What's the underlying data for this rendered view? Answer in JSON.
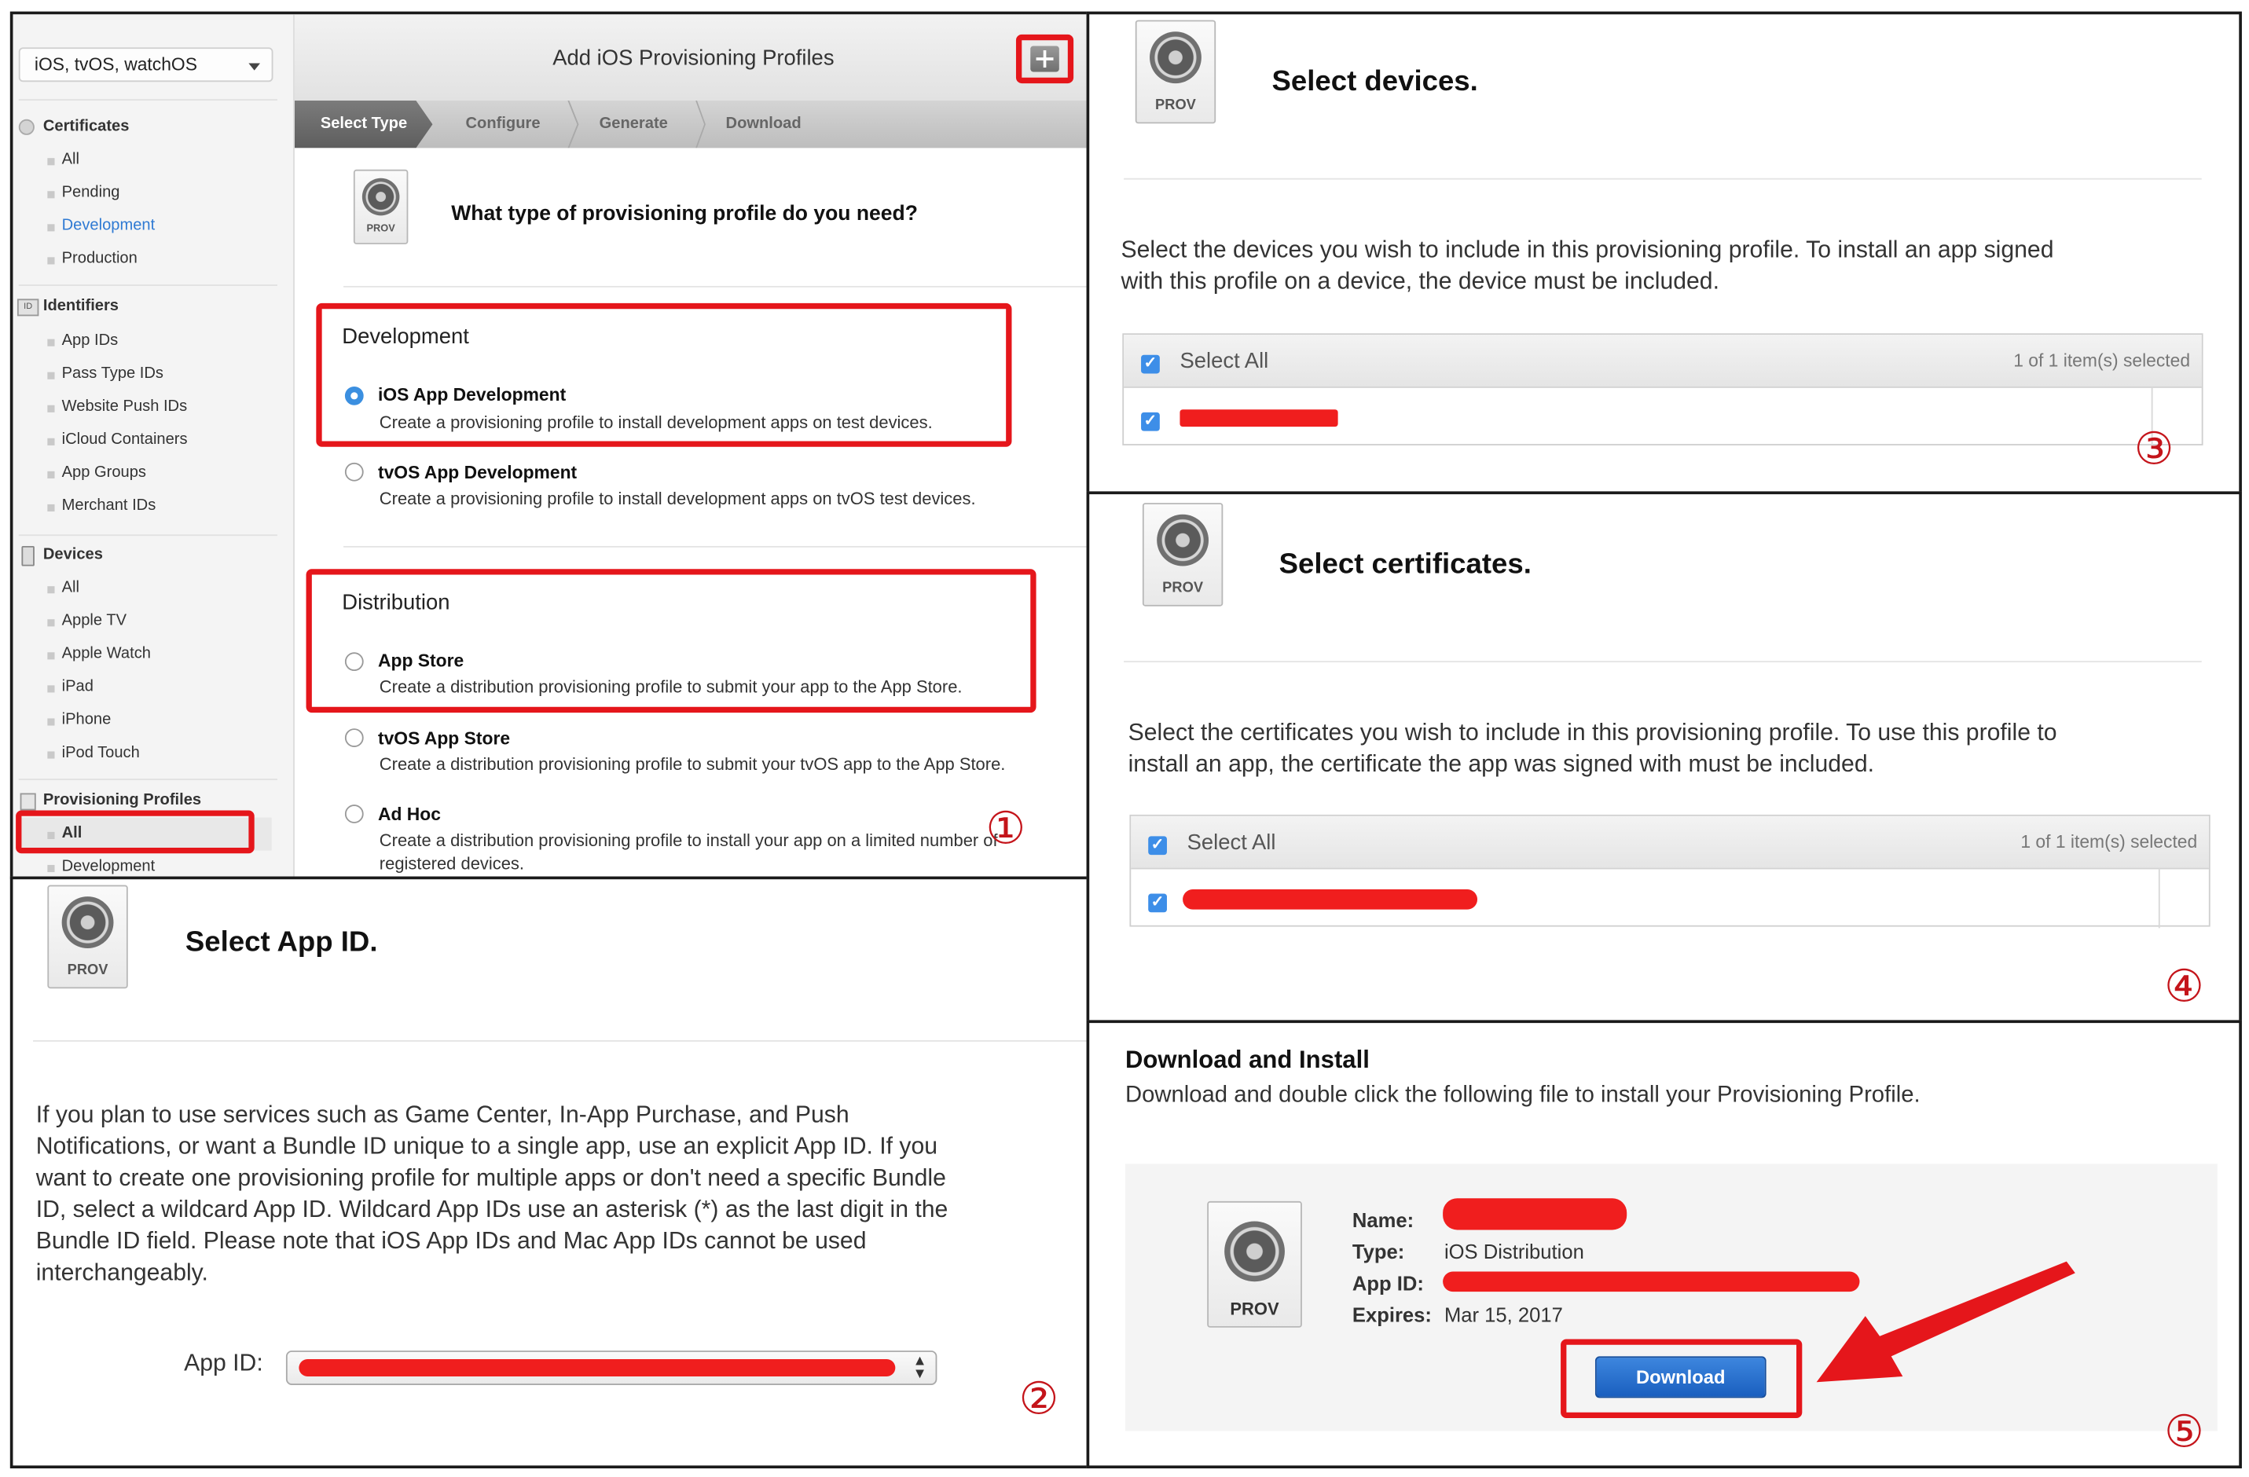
{
  "panel1": {
    "platform_select": "iOS, tvOS, watchOS",
    "header_title": "Add iOS Provisioning Profiles",
    "add_icon": "plus-icon",
    "steps": [
      "Select Type",
      "Configure",
      "Generate",
      "Download"
    ],
    "question": "What type of provisioning profile do you need?",
    "sidebar": {
      "certificates": {
        "title": "Certificates",
        "items": [
          "All",
          "Pending",
          "Development",
          "Production"
        ]
      },
      "identifiers": {
        "title": "Identifiers",
        "items": [
          "App IDs",
          "Pass Type IDs",
          "Website Push IDs",
          "iCloud Containers",
          "App Groups",
          "Merchant IDs"
        ]
      },
      "devices": {
        "title": "Devices",
        "items": [
          "All",
          "Apple TV",
          "Apple Watch",
          "iPad",
          "iPhone",
          "iPod Touch"
        ]
      },
      "profiles": {
        "title": "Provisioning Profiles",
        "items": [
          "All",
          "Development"
        ]
      },
      "identifiers_badge": "ID"
    },
    "development": {
      "heading": "Development",
      "options": [
        {
          "title": "iOS App Development",
          "desc": "Create a provisioning profile to install development apps on test devices."
        },
        {
          "title": "tvOS App Development",
          "desc": "Create a provisioning profile to install development apps on tvOS test devices."
        }
      ]
    },
    "distribution": {
      "heading": "Distribution",
      "options": [
        {
          "title": "App Store",
          "desc": "Create a distribution provisioning profile to submit your app to the App Store."
        },
        {
          "title": "tvOS App Store",
          "desc": "Create a distribution provisioning profile to submit your tvOS app to the App Store."
        },
        {
          "title": "Ad Hoc",
          "desc": "Create a distribution provisioning profile to install your app on a limited number of",
          "desc2": "registered devices."
        }
      ]
    },
    "step_number": "①"
  },
  "panel2": {
    "title": "Select App ID.",
    "paragraph": [
      "If you plan to use services such as Game Center, In-App Purchase, and Push",
      "Notifications, or want a Bundle ID unique to a single app, use an explicit App ID. If you",
      "want to create one provisioning profile for multiple apps or don't need a specific Bundle",
      "ID, select a wildcard App ID. Wildcard App IDs use an asterisk (*) as the last digit in the",
      "Bundle ID field. Please note that iOS App IDs and Mac App IDs cannot be used",
      "interchangeably."
    ],
    "app_id_label": "App ID:",
    "step_number": "②"
  },
  "panel3": {
    "title": "Select devices.",
    "paragraph": [
      "Select the devices you wish to include in this provisioning profile. To install an app signed",
      "with this profile on a device, the device must be included."
    ],
    "select_all": "Select All",
    "count": "1  of 1 item(s) selected",
    "step_number": "③"
  },
  "panel4": {
    "title": "Select certificates.",
    "paragraph": [
      "Select the certificates you wish to include in this provisioning profile. To use this profile to",
      "install an app, the certificate the app was signed with must be included."
    ],
    "select_all": "Select All",
    "count": "1  of 1 item(s) selected",
    "step_number": "④"
  },
  "panel5": {
    "title": "Download and Install",
    "subtitle": "Download and double click the following file to install your Provisioning Profile.",
    "name_label": "Name:",
    "type_label": "Type:",
    "type_value": "iOS Distribution",
    "appid_label": "App ID:",
    "expires_label": "Expires:",
    "expires_value": "Mar 15, 2017",
    "download_button": "Download",
    "step_number": "⑤"
  },
  "prov_label": "PROV",
  "colors": {
    "annotation_red": "#e5161b",
    "accent_blue": "#2f7ad3",
    "download_blue": "#1a5fbf"
  }
}
